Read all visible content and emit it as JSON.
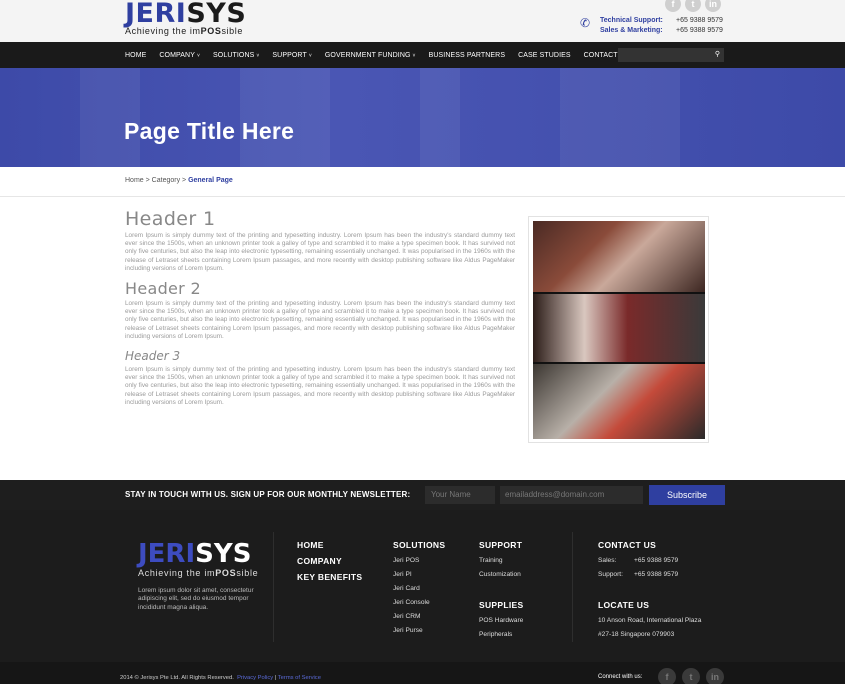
{
  "brand": {
    "logo_part1": "JERI",
    "logo_part2": "SYS",
    "tagline_pre": "Achieving the im",
    "tagline_bold": "POS",
    "tagline_post": "sible"
  },
  "header": {
    "socials": [
      "f",
      "t",
      "in"
    ],
    "contact": [
      {
        "label": "Technical Support:",
        "value": "+65 9388 9579"
      },
      {
        "label": "Sales & Marketing:",
        "value": "+65 9388 9579"
      }
    ]
  },
  "nav": {
    "items": [
      {
        "label": "HOME",
        "dropdown": false
      },
      {
        "label": "COMPANY",
        "dropdown": true
      },
      {
        "label": "SOLUTIONS",
        "dropdown": true
      },
      {
        "label": "SUPPORT",
        "dropdown": true
      },
      {
        "label": "GOVERNMENT FUNDING",
        "dropdown": true
      },
      {
        "label": "BUSINESS PARTNERS",
        "dropdown": false
      },
      {
        "label": "CASE STUDIES",
        "dropdown": false
      },
      {
        "label": "CONTACT US",
        "dropdown": false
      }
    ],
    "caret": "˅",
    "search_icon": "🔍"
  },
  "banner": {
    "title": "Page Title Here"
  },
  "breadcrumb": {
    "home": "Home",
    "sep": " > ",
    "category": "Category",
    "current": "General Page"
  },
  "content": {
    "header1": "Header 1",
    "header2": "Header 2",
    "header3": "Header 3",
    "lorem": "Lorem Ipsum is simply dummy text of the printing and typesetting industry. Lorem Ipsum has been the industry's standard dummy text ever since the 1500s, when an unknown printer took a galley of type and scrambled it to make a type specimen book. It has survived not only five centuries, but also the leap into electronic typesetting, remaining essentially unchanged. It was popularised in the 1960s with the release of Letraset sheets containing Lorem Ipsum passages, and more recently with desktop publishing software like Aldus PageMaker including versions of Lorem Ipsum."
  },
  "newsletter": {
    "text": "STAY IN TOUCH WITH US. SIGN UP FOR OUR MONTHLY NEWSLETTER:",
    "name_placeholder": "Your Name",
    "email_placeholder": "emailaddress@domain.com",
    "button": "Subscribe"
  },
  "footer": {
    "about": "Lorem ipsum dolor sit amet, consectetur adipiscing elit, sed do eiusmod tempor incididunt magna aliqua.",
    "main_links": [
      "HOME",
      "COMPANY",
      "KEY BENEFITS"
    ],
    "solutions": {
      "head": "SOLUTIONS",
      "links": [
        "Jeri POS",
        "Jeri PI",
        "Jeri Card",
        "Jeri Console",
        "Jeri CRM",
        "Jeri Purse"
      ]
    },
    "support": {
      "head": "SUPPORT",
      "links": [
        "Training",
        "Customization"
      ]
    },
    "supplies": {
      "head": "SUPPLIES",
      "links": [
        "POS Hardware",
        "Peripherals"
      ]
    },
    "contact": {
      "head": "CONTACT US",
      "rows": [
        {
          "label": "Sales:",
          "value": "+65 9388 9579"
        },
        {
          "label": "Support:",
          "value": "+65 9388 9579"
        }
      ]
    },
    "locate": {
      "head": "LOCATE US",
      "line1": "10 Anson Road, International Plaza",
      "line2": "#27-18 Singapore 079903"
    }
  },
  "bottom": {
    "copyright": "2014 © Jerisys Pte Ltd. All Rights Reserved.",
    "privacy": "Privacy Policy",
    "sep": " | ",
    "terms": "Terms of Service",
    "connect": "Connect with us:",
    "socials": [
      "f",
      "t",
      "in"
    ]
  },
  "colors": {
    "brand_blue": "#2f3fa0",
    "nav_bg": "#1a1a1a",
    "banner_blue": "#4a56b4",
    "footer_bg": "#1c1c1c"
  }
}
